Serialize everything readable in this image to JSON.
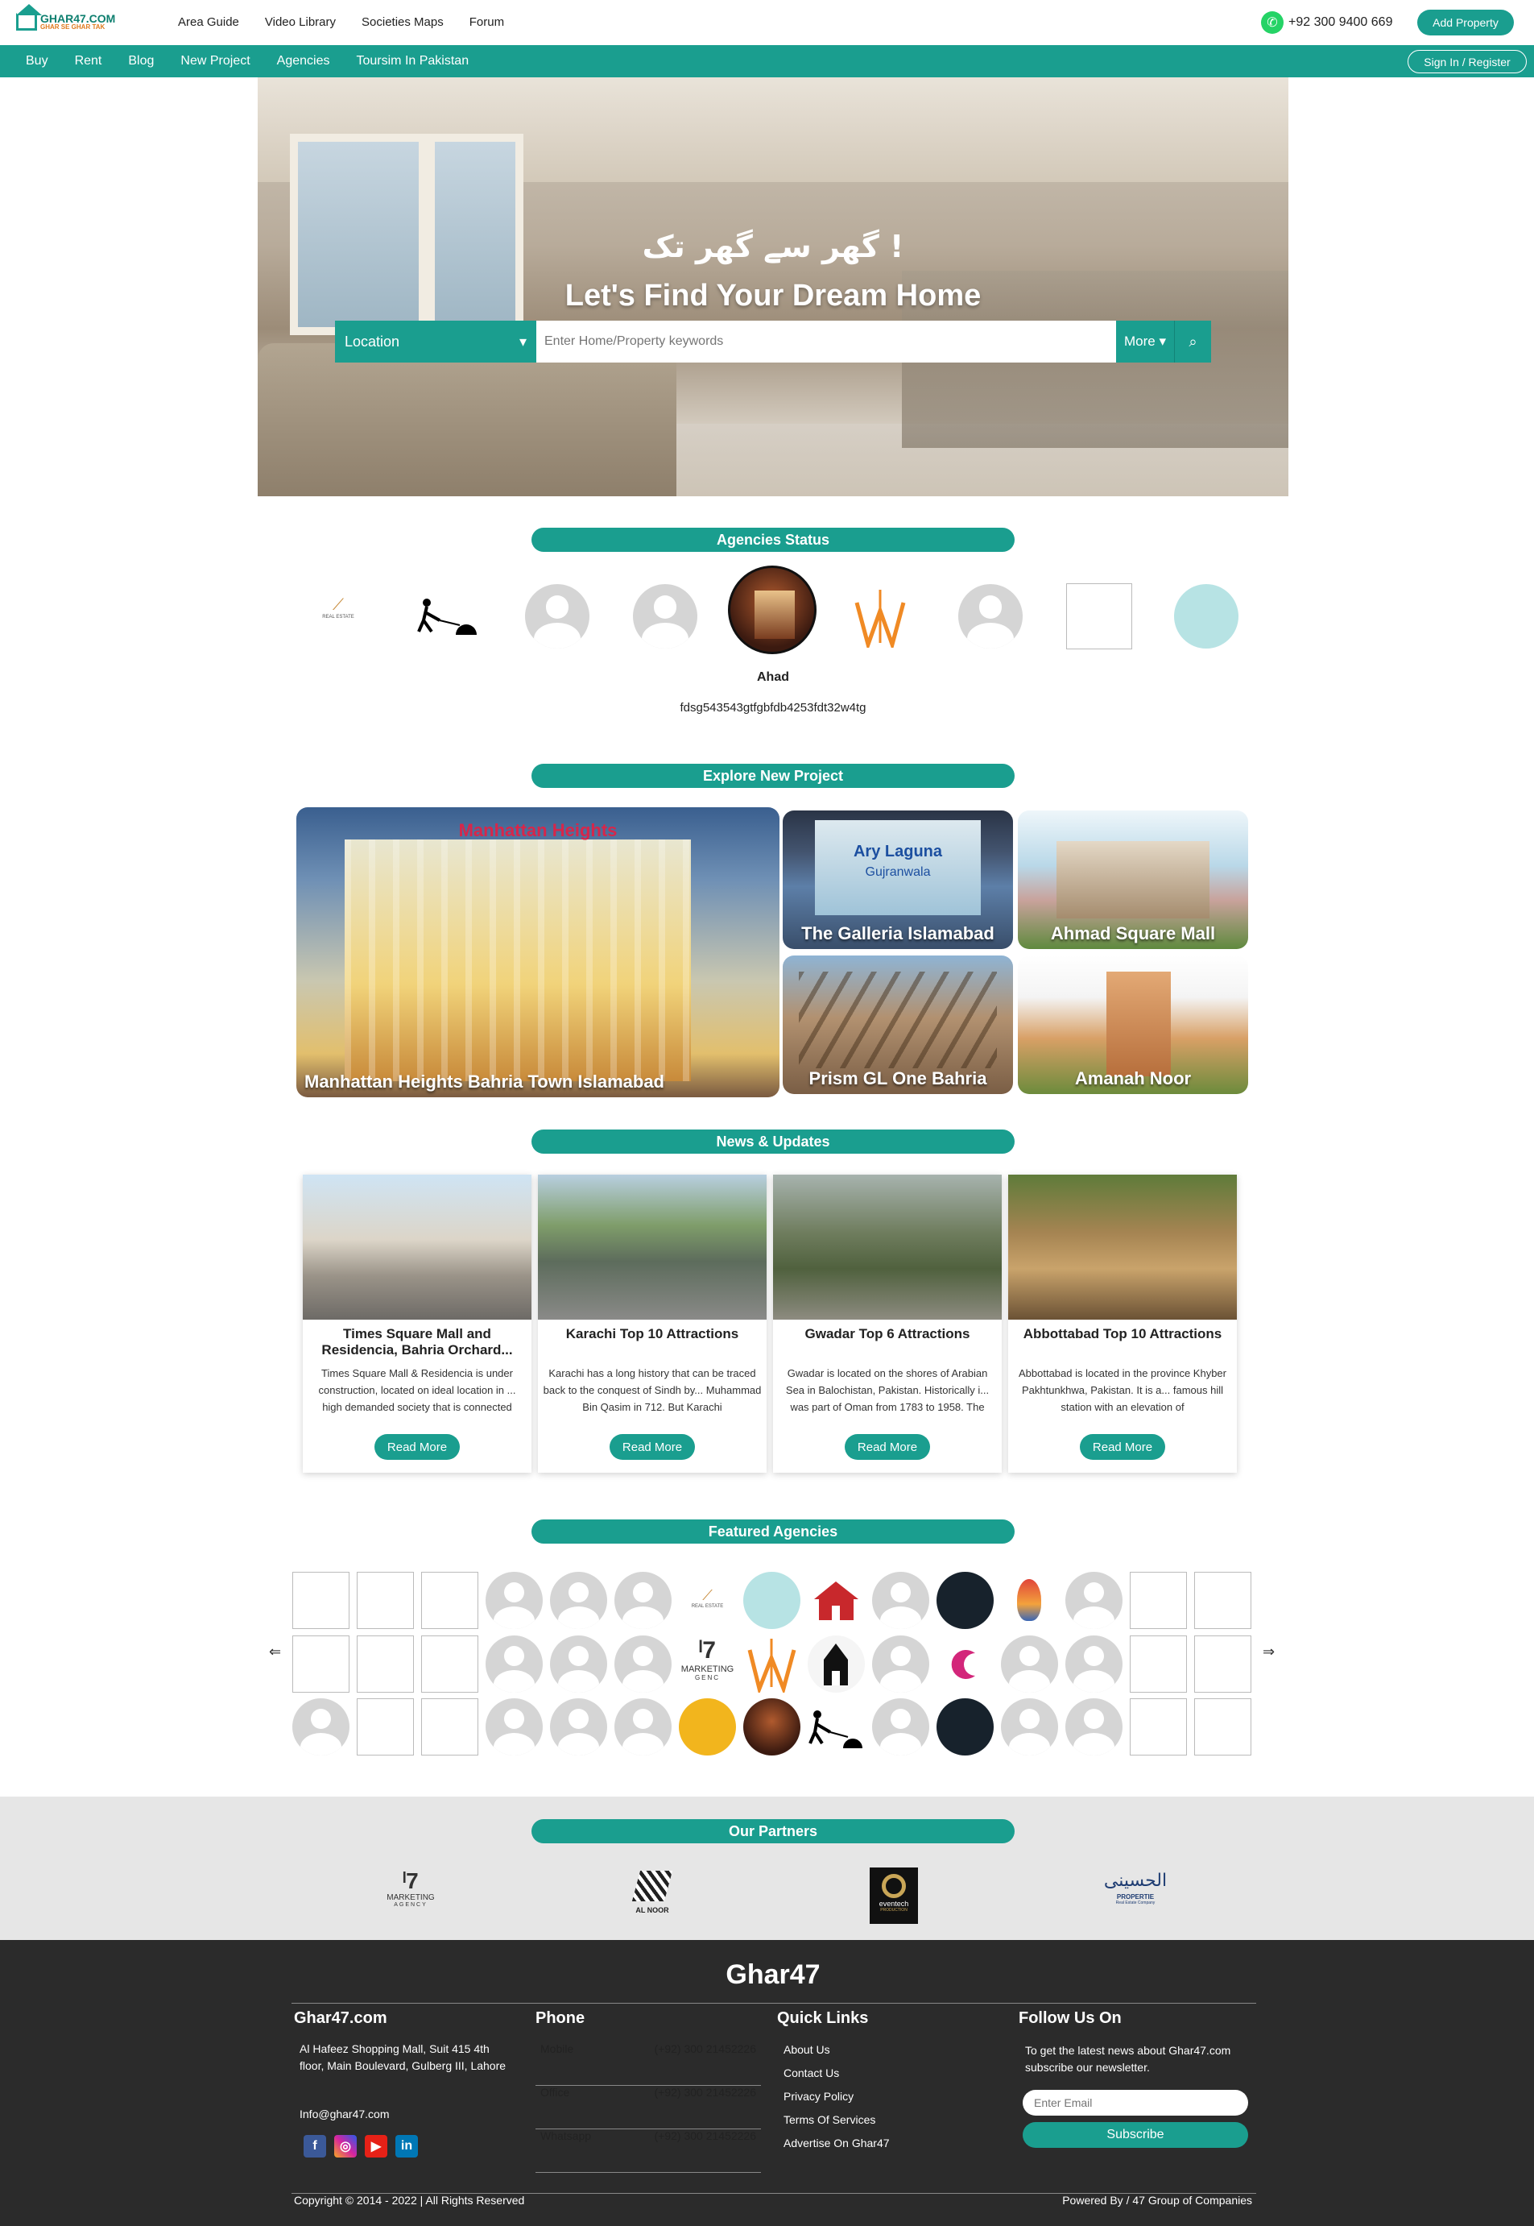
{
  "header": {
    "logo_main": "GHAR47.COM",
    "logo_sub": "GHAR SE GHAR TAK",
    "top_links": [
      "Area Guide",
      "Video Library",
      "Societies Maps",
      "Forum"
    ],
    "phone": "+92 300 9400 669",
    "add_property": "Add Property"
  },
  "nav": {
    "links": [
      "Buy",
      "Rent",
      "Blog",
      "New Project",
      "Agencies",
      "Toursim In Pakistan"
    ],
    "signin": "Sign In / Register"
  },
  "hero": {
    "urdu": "گھر سے گھر تک !",
    "title": "Let's Find Your Dream Home",
    "location_label": "Location",
    "search_placeholder": "Enter Home/Property keywords",
    "more_label": "More",
    "search_icon": "search-icon"
  },
  "agencies_status": {
    "title": "Agencies Status",
    "active_name": "Ahad",
    "active_desc": "fdsg543543gtfgbfdb4253fdt32w4tg",
    "logo_real_estate": "REAL ESTATE"
  },
  "projects": {
    "title": "Explore New Project",
    "big": {
      "name": "Manhattan Heights Bahria Town Islamabad",
      "sign": "Manhattan Heights"
    },
    "small": [
      {
        "name": "The Galleria Islamabad",
        "sign_top": "Ary Laguna",
        "sign_sub": "Gujranwala"
      },
      {
        "name": "Ahmad Square Mall"
      },
      {
        "name": "Prism GL One Bahria"
      },
      {
        "name": "Amanah Noor"
      }
    ]
  },
  "news": {
    "title": "News & Updates",
    "read_more": "Read More",
    "items": [
      {
        "title": "Times Square Mall and Residencia, Bahria Orchard...",
        "body": "Times Square Mall & Residencia is under construction, located on ideal location in ... high demanded society that is connected"
      },
      {
        "title": "Karachi Top 10 Attractions",
        "body": "Karachi has a long history that can be traced back to the conquest of Sindh by... Muhammad Bin Qasim in 712. But Karachi"
      },
      {
        "title": "Gwadar Top 6 Attractions",
        "body": "Gwadar is located on the shores of Arabian Sea in Balochistan, Pakistan. Historically i... was part of Oman from 1783 to 1958. The"
      },
      {
        "title": "Abbottabad Top 10 Attractions",
        "body": "Abbottabad is located in the province Khyber Pakhtunkhwa, Pakistan. It is a... famous hill station with an elevation of"
      }
    ]
  },
  "featured": {
    "title": "Featured Agencies",
    "prev": "⇐",
    "next": "⇒",
    "marketing_label": "MARKETING",
    "marketing_sub": "GENC",
    "logo_real_estate": "REAL ESTATE"
  },
  "partners": {
    "title": "Our Partners",
    "items": [
      {
        "name": "MARKETING",
        "sub": "AGENCY"
      },
      {
        "name": "AL NOOR"
      },
      {
        "name": "eventech",
        "sub": "PRODUCTION"
      },
      {
        "name": "الحسینی",
        "sub": "PROPERTIE",
        "tag": "Real Estate Company"
      }
    ]
  },
  "footer": {
    "brand": "Ghar47",
    "col1": {
      "title": "Ghar47.com",
      "address": "Al Hafeez Shopping Mall, Suit 415 4th floor, Main Boulevard, Gulberg III, Lahore",
      "email": "Info@ghar47.com"
    },
    "col2": {
      "title": "Phone",
      "rows": [
        {
          "label": "Mobile",
          "value": "(+92) 300 21452226"
        },
        {
          "label": "Office",
          "value": "(+92) 300 21452226"
        },
        {
          "label": "Whatsapp",
          "value": "(+92) 300 21452226"
        }
      ]
    },
    "col3": {
      "title": "Quick Links",
      "links": [
        "About Us",
        "Contact Us",
        "Privacy Policy",
        "Terms Of Services",
        "Advertise On Ghar47"
      ]
    },
    "col4": {
      "title": "Follow Us On",
      "text": "To get the latest news about Ghar47.com subscribe our newsletter.",
      "email_placeholder": "Enter Email",
      "subscribe": "Subscribe"
    },
    "copyright": "Copyright © 2014 - 2022 | All Rights Reserved",
    "powered": "Powered By / 47 Group of Companies"
  },
  "colors": {
    "accent": "#1a9e8f",
    "footer": "#2b2b2b",
    "partners_bg": "#e6e6e6"
  }
}
